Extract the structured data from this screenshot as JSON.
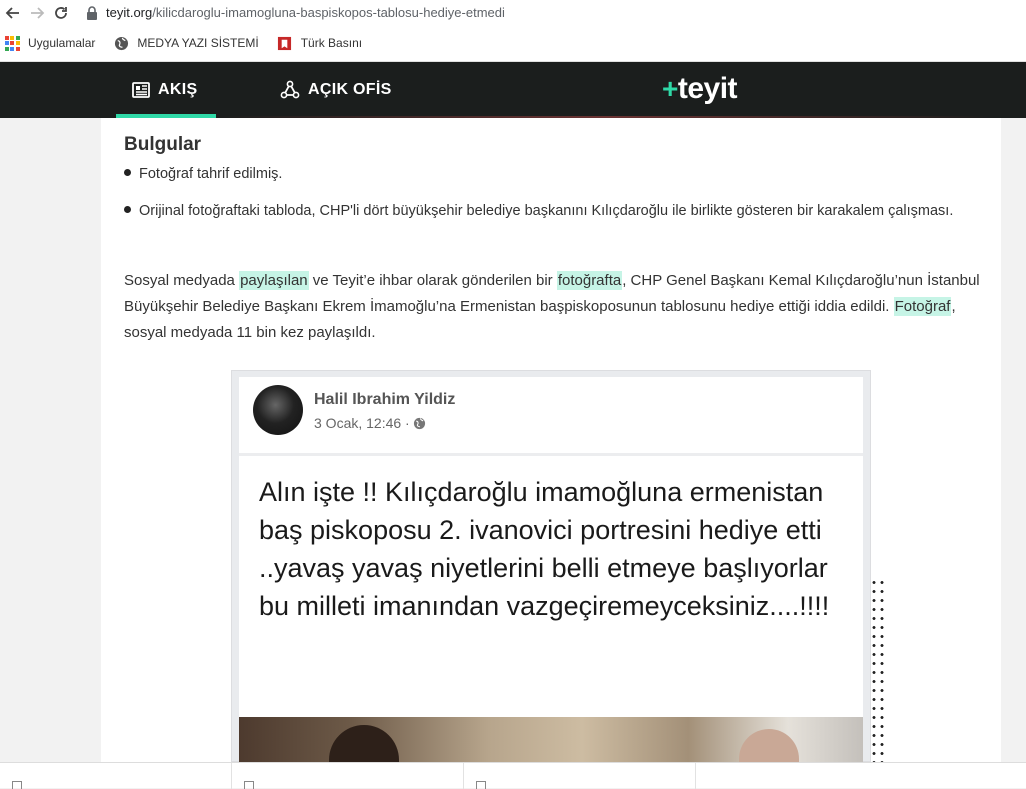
{
  "browser": {
    "url_host": "teyit.org",
    "url_path": "/kilicdaroglu-imamogluna-baspiskopos-tablosu-hediye-etmedi",
    "bookmarks": [
      {
        "label": "Uygulamalar",
        "icon": "apps-grid-icon"
      },
      {
        "label": "MEDYA YAZI SİSTEMİ",
        "icon": "globe-icon"
      },
      {
        "label": "Türk Basını",
        "icon": "red-bookmark-icon"
      }
    ]
  },
  "header": {
    "tabs": [
      {
        "label": "AKIŞ",
        "icon": "newspaper-icon",
        "active": true
      },
      {
        "label": "AÇIK OFİS",
        "icon": "triangle-circles-icon",
        "active": false
      }
    ],
    "logo_plus": "+",
    "logo_text": "teyit",
    "accent_color": "#2fd9a7"
  },
  "article": {
    "findings_title": "Bulgular",
    "findings": [
      "Fotoğraf tahrif edilmiş.",
      "Orijinal fotoğraftaki tabloda, CHP'li dört büyükşehir belediye başkanını Kılıçdaroğlu ile birlikte gösteren bir karakalem çalışması."
    ],
    "paragraph": {
      "p1": "Sosyal medyada ",
      "link1": "paylaşılan",
      "p2": " ve Teyit’e ihbar olarak gönderilen bir ",
      "link2": "fotoğrafta",
      "p3": ", CHP Genel Başkanı Kemal Kılıçdaroğlu’nun İstanbul Büyükşehir Belediye Başkanı Ekrem İmamoğlu’na Ermenistan başpiskoposunun tablosunu hediye ettiği iddia edildi. ",
      "link3": "Fotoğraf",
      "p4": ", sosyal medyada 11 bin kez paylaşıldı."
    }
  },
  "embed": {
    "author": "Halil Ibrahim Yildiz",
    "date": "3 Ocak, 12:46 · ",
    "privacy_icon": "globe-icon",
    "post_text": "Alın işte !! Kılıçdaroğlu imamoğluna ermenistan baş piskoposu 2. ivanovici portresini hediye etti ..yavaş yavaş niyetlerini belli etmeye başlıyorlar bu milleti imanından vazgeçiremeyceksiniz....!!!!"
  }
}
